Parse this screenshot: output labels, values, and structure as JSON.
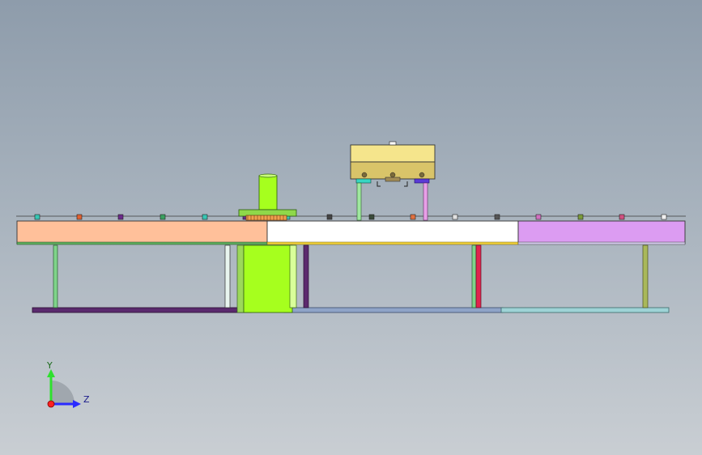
{
  "viewport": {
    "background_top": "#8e9cab",
    "background_bottom": "#c9ced3"
  },
  "model": {
    "view": "side elevation",
    "colors": {
      "section_left": "#ffc09a",
      "section_center": "#ffffff",
      "section_right": "#dc9cf2",
      "column": "#a6ff1e",
      "fixture_top": "#f5e58c",
      "base_left": "#5a2a6e",
      "base_right": "#8fa4c8",
      "base_far_right": "#9ed3d6"
    }
  },
  "triad": {
    "y_label": "Y",
    "z_label": "Z",
    "y_color": "#2ee02e",
    "z_color": "#2a2aff",
    "x_color": "#ff2020"
  }
}
